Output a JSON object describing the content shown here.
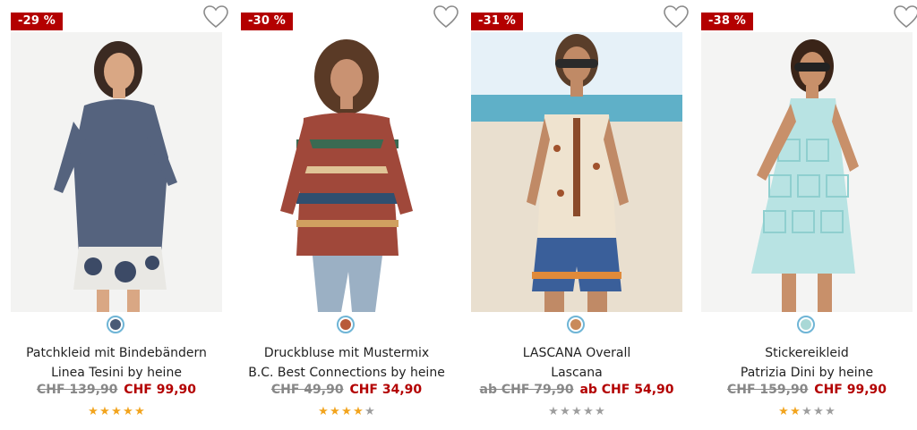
{
  "colors": {
    "badge_bg": "#b30000",
    "sale_price": "#b30000",
    "old_price": "#888888",
    "star_filled": "#f2a41e",
    "star_empty": "#9e9e9e",
    "swatch_ring": "#6fb5d6"
  },
  "products": [
    {
      "discount": "-29 %",
      "name": "Patchkleid mit Bindebändern",
      "brand": "Linea Tesini by heine",
      "old_price": "CHF 139,90",
      "new_price": "CHF 99,90",
      "rating": 5,
      "rating_max": 5,
      "swatch_color": "#4a5a75",
      "wishlist_icon": "heart-outline-icon"
    },
    {
      "discount": "-30 %",
      "name": "Druckbluse mit Mustermix",
      "brand": "B.C. Best Connections by heine",
      "old_price": "CHF 49,90",
      "new_price": "CHF 34,90",
      "rating": 4,
      "rating_max": 5,
      "swatch_color": "#b85a3a",
      "wishlist_icon": "heart-outline-icon"
    },
    {
      "discount": "-31 %",
      "name": "LASCANA Overall",
      "brand": "Lascana",
      "old_price": "ab CHF 79,90",
      "new_price": "ab CHF 54,90",
      "rating": 0,
      "rating_max": 5,
      "swatch_color": "#c98a5a",
      "wishlist_icon": "heart-outline-icon"
    },
    {
      "discount": "-38 %",
      "name": "Stickereikleid",
      "brand": "Patrizia Dini by heine",
      "old_price": "CHF 159,90",
      "new_price": "CHF 99,90",
      "rating": 2,
      "rating_max": 5,
      "swatch_color": "#a9d8d6",
      "wishlist_icon": "heart-outline-icon"
    }
  ]
}
